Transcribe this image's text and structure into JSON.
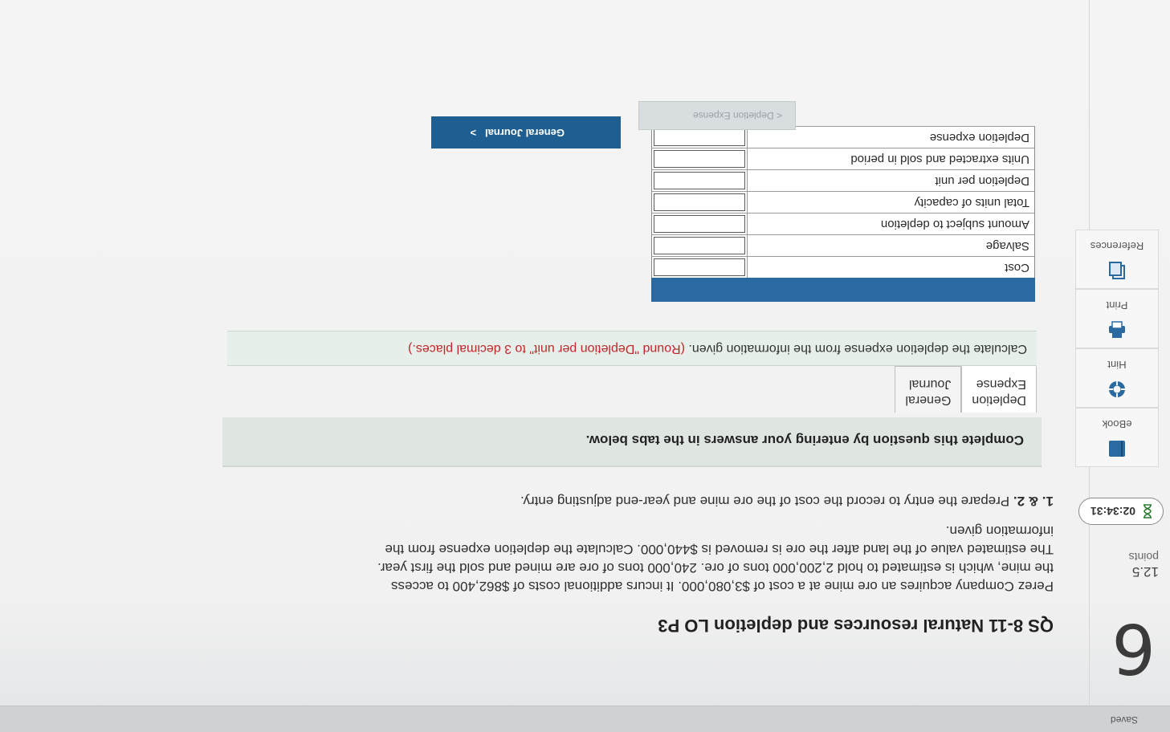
{
  "header": {
    "saved": "Saved"
  },
  "question": {
    "number": "6",
    "points_value": "12.5",
    "points_label": "points",
    "timer": "02:34:31",
    "title": "QS 8-11 Natural resources and depletion LO P3",
    "problem_text": "Perez Company acquires an ore mine at a cost of $3,080,000. It incurs additional costs of $862,400 to access the mine, which is estimated to hold 2,200,000 tons of ore. 240,000 tons of ore are mined and sold the first year. The estimated value of the land after the ore is removed is $440,000. Calculate the depletion expense from the information given.",
    "requirements_label": "1. & 2.",
    "requirements_text": "Prepare the entry to record the cost of the ore mine and year-end adjusting entry."
  },
  "tools": [
    {
      "label": "eBook",
      "icon": "book-icon"
    },
    {
      "label": "Hint",
      "icon": "lifebuoy-icon"
    },
    {
      "label": "Print",
      "icon": "printer-icon"
    },
    {
      "label": "References",
      "icon": "copy-icon"
    }
  ],
  "instructions": "Complete this question by entering your answers in the tabs below.",
  "tabs": [
    {
      "line1": "Depletion",
      "line2": "Expense",
      "active": true
    },
    {
      "line1": "General",
      "line2": "Journal",
      "active": false
    }
  ],
  "calc": {
    "text": "Calculate the depletion expense from the information given.",
    "note": "(Round \"Depletion per unit\" to 3 decimal places.)"
  },
  "table": {
    "rows": [
      {
        "label": "Cost",
        "value": ""
      },
      {
        "label": "Salvage",
        "value": ""
      },
      {
        "label": "Amount subject to depletion",
        "value": ""
      },
      {
        "label": "Total units of capacity",
        "value": ""
      },
      {
        "label": "Depletion per unit",
        "value": ""
      },
      {
        "label": "Units extracted and sold in period",
        "value": ""
      },
      {
        "label": "Depletion expense",
        "value": ""
      }
    ]
  },
  "nav": {
    "prev": "Depletion Expense",
    "next": "General Journal"
  },
  "colors": {
    "primary": "#1f5e91",
    "table_header": "#2b6aa0",
    "note_red": "#c0282c"
  }
}
